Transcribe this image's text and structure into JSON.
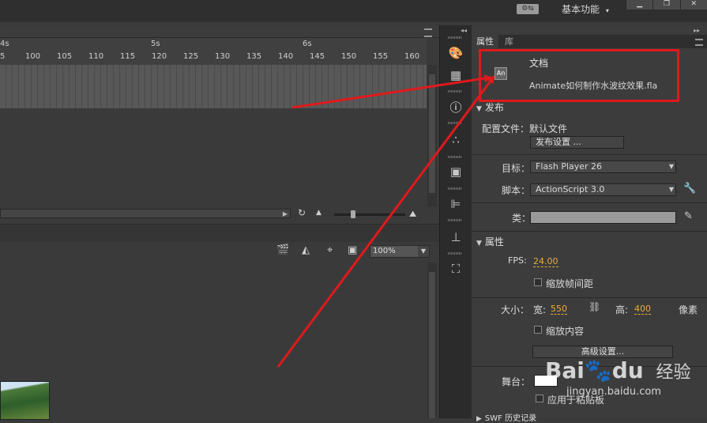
{
  "topbar": {
    "sync_glyph": "⚙⇆",
    "workspace_label": "基本功能",
    "workspace_caret": "▾",
    "window_buttons": [
      "▁",
      "❐",
      "✕"
    ]
  },
  "timeline": {
    "seconds": [
      "4s",
      "5s",
      "6s"
    ],
    "frames": [
      "5",
      "100",
      "105",
      "110",
      "115",
      "120",
      "125",
      "130",
      "135",
      "140",
      "145",
      "150",
      "155",
      "160"
    ]
  },
  "stage": {
    "zoom_value": "100%"
  },
  "properties": {
    "tab_properties": "属性",
    "tab_library": "库",
    "doc_label": "文档",
    "doc_filename": "Animate如何制作水波纹效果.fla",
    "publish_section": "发布",
    "profile_label": "配置文件：",
    "profile_value": "默认文件",
    "publish_settings_button": "发布设置 ...",
    "target_label": "目标：",
    "target_value": "Flash Player 26",
    "script_label": "脚本：",
    "script_value": "ActionScript 3.0",
    "class_label": "类：",
    "properties_section": "属性",
    "fps_label": "FPS:",
    "fps_value": "24.00",
    "scale_spans_label": "缩放帧间距",
    "size_label": "大小：",
    "width_label": "宽:",
    "width_value": "550",
    "height_label": "高:",
    "height_value": "400",
    "pixels_label": "像素",
    "scale_content_label": "缩放内容",
    "advanced_settings_button": "高级设置...",
    "stage_label": "舞台：",
    "apply_pasteboard_label": "应用于粘贴板",
    "swf_history_section": "SWF 历史记录"
  },
  "watermark": {
    "brand": "Bai",
    "brand_tail": "du",
    "jingyan": "经验",
    "url": "jingyan.baidu.com"
  },
  "annotations": {
    "highlight_color": "#e0191c",
    "arrow_color": "#e0191c"
  }
}
